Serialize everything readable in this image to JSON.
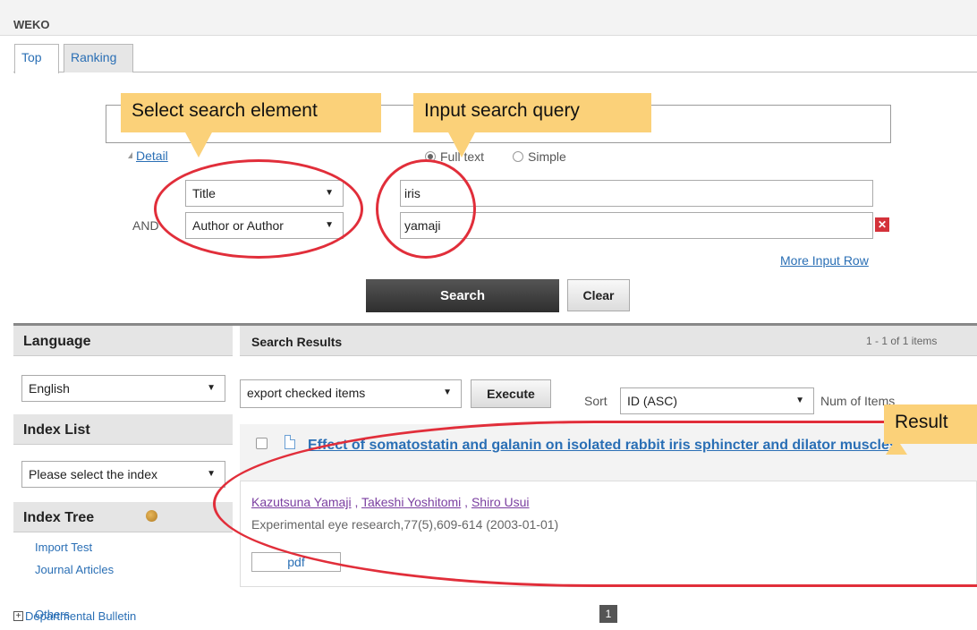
{
  "app": {
    "name": "WEKO"
  },
  "tabs": [
    {
      "label": "Top"
    },
    {
      "label": "Ranking"
    }
  ],
  "search": {
    "detail_label": "Detail",
    "mode_full": "Full text",
    "mode_simple": "Simple",
    "rows": [
      {
        "connector": "",
        "element": "Title",
        "query": "iris"
      },
      {
        "connector": "AND",
        "element": "Author or Author",
        "query": "yamaji"
      }
    ],
    "more_rows_label": "More Input Row",
    "search_button": "Search",
    "clear_button": "Clear"
  },
  "sidebar": {
    "language_heading": "Language",
    "language_value": "English",
    "index_list_heading": "Index List",
    "index_list_value": "Please select the index",
    "index_tree_heading": "Index Tree",
    "tree_items": [
      "Import Test",
      "Journal Articles",
      "Departmental Bulletin",
      "Others"
    ]
  },
  "results": {
    "heading": "Search Results",
    "count": "1 - 1 of 1 items",
    "export_option": "export checked items",
    "execute_button": "Execute",
    "sort_label": "Sort",
    "sort_value": "ID (ASC)",
    "num_items_label": "Num of Items",
    "items": [
      {
        "title": "Effect of somatostatin and galanin on isolated rabbit iris sphincter and dilator muscles.",
        "authors": [
          "Kazutsuna Yamaji",
          "Takeshi Yoshitomi",
          "Shiro Usui"
        ],
        "citation": "Experimental eye research,77(5),609-614 (2003-01-01)",
        "file_label": "pdf"
      }
    ],
    "current_page": "1"
  },
  "annotations": {
    "select_element": "Select search element",
    "input_query": "Input search query",
    "result": "Result",
    "color": "#fbd179",
    "ellipse_color": "#e12e3a"
  }
}
